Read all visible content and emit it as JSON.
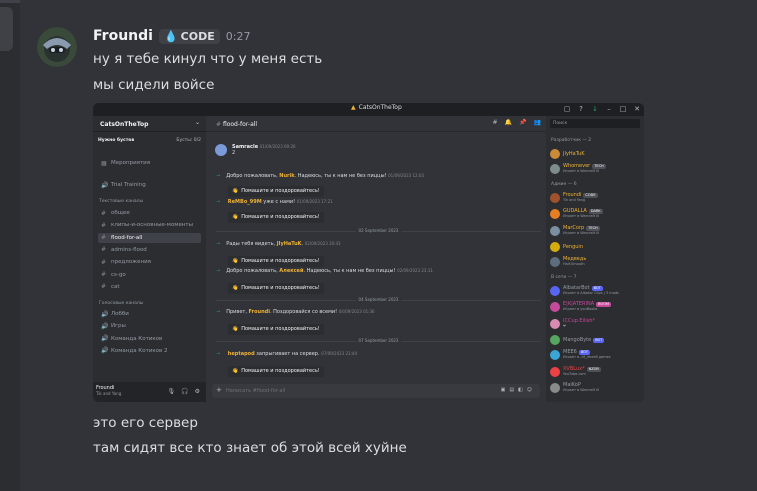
{
  "message": {
    "author": "Froundi",
    "tag": "CODE",
    "time": "0:27",
    "lines_top": [
      "ну я тебе кинул что у меня есть",
      "мы сидели войсе"
    ],
    "lines_bottom": [
      "это его сервер",
      "там сидят все кто знает об этой всей хуйне"
    ]
  },
  "inner": {
    "window_title": "CatsOnTheTop",
    "server_name": "CatsOnTheTop",
    "boost_left": "Нужно бустов",
    "boost_right": "Бусты: 0/2",
    "channels_top": [
      {
        "label": "Мероприятия",
        "glyph": "▦"
      },
      {
        "label": "Trial Training",
        "glyph": "🔊"
      }
    ],
    "text_cat": "Текстовые каналы",
    "text_channels": [
      "общее",
      "клипы-и-основные-моменты",
      "flood-for-all",
      "admins-flood",
      "предложения",
      "cs-go",
      "cat"
    ],
    "active_channel_index": 2,
    "voice_cat": "Голосовые каналы",
    "voice_channels": [
      "Лобби",
      "Игры",
      "Команда Котиков",
      "Команда Котиков 2"
    ],
    "user_name": "Froundi",
    "user_status": "Tik and Yang",
    "channel_header": "flood-for-all",
    "messages": [
      {
        "type": "msg",
        "name": "Samracle",
        "ts": "01/09/2023 09:26",
        "text": "2"
      },
      {
        "type": "join",
        "pre": "Добро пожаловать,",
        "who": "Nurik",
        "post": ". Надеюсь, ты к нам не без пиццы!",
        "ts": "01/09/2023 12:03"
      },
      {
        "type": "wave",
        "label": "Помашите и поздоровайтесь!"
      },
      {
        "type": "join",
        "pre": "",
        "who": "ReMBo_99M",
        "post": " уже с нами!",
        "ts": "01/09/2023 17:21"
      },
      {
        "type": "wave",
        "label": "Помашите и поздоровайтесь!"
      },
      {
        "type": "sep",
        "label": "02 September 2023"
      },
      {
        "type": "join",
        "pre": "Рады тебя видеть,",
        "who": "JIyHaTuK",
        "post": ".",
        "ts": "02/09/2023 20:43"
      },
      {
        "type": "wave",
        "label": "Помашите и поздоровайтесь!"
      },
      {
        "type": "join",
        "pre": "Добро пожаловать,",
        "who": "Алексей",
        "post": ". Надеюсь, ты к нам не без пиццы!",
        "ts": "02/09/2023 23:11"
      },
      {
        "type": "wave",
        "label": "Помашите и поздоровайтесь!"
      },
      {
        "type": "sep",
        "label": "04 September 2023"
      },
      {
        "type": "join",
        "pre": "Привет,",
        "who": "Froundi",
        "post": ". Поздоровайся со всеми!",
        "ts": "04/09/2023 01:36"
      },
      {
        "type": "wave",
        "label": "Помашите и поздоровайтесь!"
      },
      {
        "type": "sep",
        "label": "07 September 2023"
      },
      {
        "type": "join",
        "pre": "",
        "who": "heptapod",
        "post": " запрыгивает на сервер.",
        "ts": "07/09/2023 23:44"
      },
      {
        "type": "wave",
        "label": "Помашите и поздоровайтесь!"
      }
    ],
    "input_placeholder": "Написать #flood-for-all",
    "search_placeholder": "Поиск",
    "members": [
      {
        "kind": "cat",
        "label": "Разработчик — 2"
      },
      {
        "kind": "mem",
        "name": "JIyHaTuK",
        "color": "#f0b232",
        "status": ""
      },
      {
        "kind": "mem",
        "name": "Whomever",
        "color": "#f0b232",
        "badge": "TECH",
        "status": "Играет в Warcraft III"
      },
      {
        "kind": "cat",
        "label": "Админ — 6"
      },
      {
        "kind": "mem",
        "name": "Froundi",
        "color": "#f0b232",
        "badge": "CODE",
        "status": "Tik and Yang"
      },
      {
        "kind": "mem",
        "name": "GUDALLA",
        "color": "#f0b232",
        "badge": "DARK",
        "status": "Играет в Warcraft III"
      },
      {
        "kind": "mem",
        "name": "MarCorp",
        "color": "#f0b232",
        "badge": "TECH",
        "status": "Играет в Warcraft III"
      },
      {
        "kind": "mem",
        "name": "Penguin",
        "color": "#f0b232",
        "status": ""
      },
      {
        "kind": "mem",
        "name": "Медведь",
        "color": "#f0b232",
        "status": "Half-Smooth"
      },
      {
        "kind": "cat",
        "label": "В сети — 7"
      },
      {
        "kind": "mem",
        "name": "AlbatarBot",
        "color": "#949ba4",
        "badge": "BOT",
        "status": "Играет в Albatar Clips | 3 mods"
      },
      {
        "kind": "mem",
        "name": "E|K|ATERINA",
        "color": "#c64a9b",
        "badge": "BOOM",
        "status": "Играет в youBoobs"
      },
      {
        "kind": "mem",
        "name": "ICCup.Eilish*",
        "color": "#c64a9b",
        "status": "❤"
      },
      {
        "kind": "mem",
        "name": "MangoByte",
        "color": "#949ba4",
        "badge": "BOT",
        "status": ""
      },
      {
        "kind": "mem",
        "name": "MEE6",
        "color": "#949ba4",
        "badge": "BOT",
        "status": "Играет в .df_/mee6 games"
      },
      {
        "kind": "mem",
        "name": "XVBLux*",
        "color": "#ed4245",
        "badge": "NZOR",
        "status": "YouTube.com"
      },
      {
        "kind": "mem",
        "name": "MaiKoP",
        "color": "#949ba4",
        "status": "Играет в Warcraft III"
      }
    ]
  }
}
